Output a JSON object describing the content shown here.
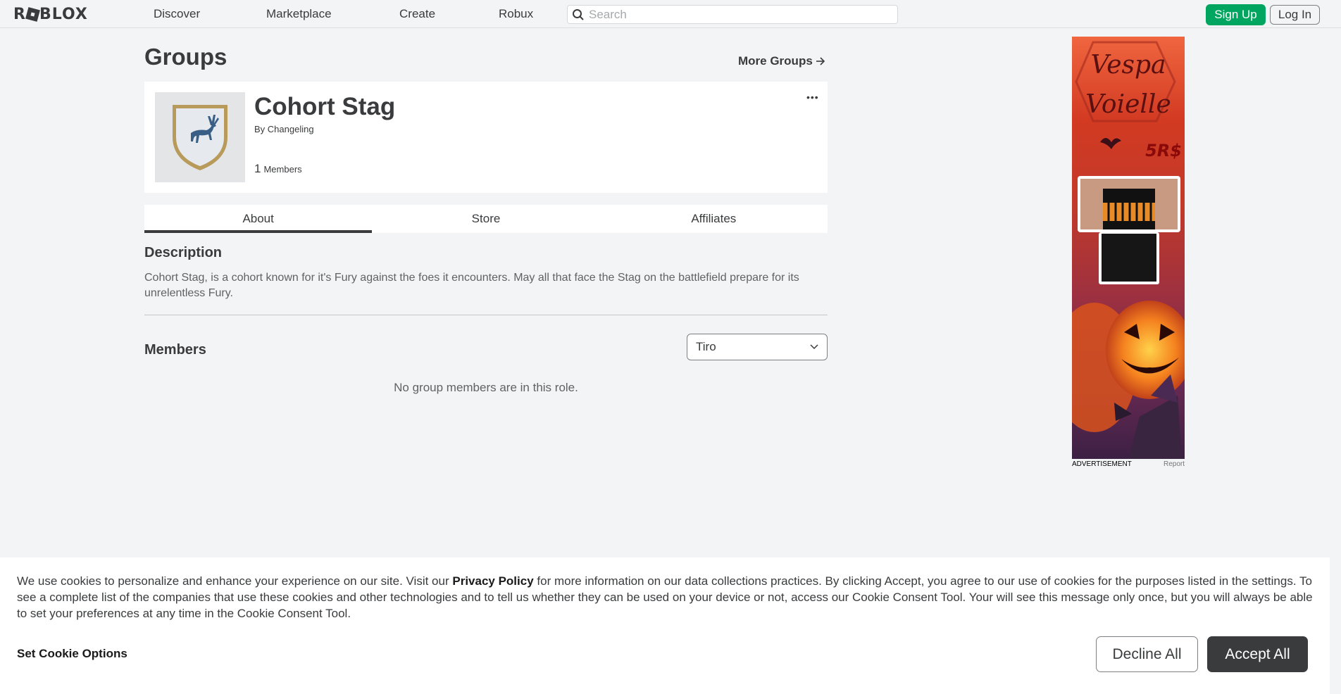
{
  "nav": {
    "logo": "ROBLOX",
    "links": [
      "Discover",
      "Marketplace",
      "Create",
      "Robux"
    ],
    "search_placeholder": "Search",
    "signup_label": "Sign Up",
    "login_label": "Log In"
  },
  "page": {
    "title": "Groups",
    "more_groups": "More Groups"
  },
  "group": {
    "name": "Cohort Stag",
    "by_label": "By",
    "owner": "Changeling",
    "member_count": "1",
    "members_label": "Members",
    "menu_glyph": "•••"
  },
  "tabs": [
    {
      "label": "About",
      "active": true
    },
    {
      "label": "Store",
      "active": false
    },
    {
      "label": "Affiliates",
      "active": false
    }
  ],
  "about": {
    "description_title": "Description",
    "description_text": "Cohort Stag, is a cohort known for it's Fury against the foes it encounters. May all that face the Stag on the battlefield prepare for its unrelentless Fury.",
    "members_title": "Members",
    "role_selected": "Tiro",
    "empty_message": "No group members are in this role."
  },
  "ad": {
    "label": "ADVERTISEMENT",
    "report": "Report",
    "line1": "Vespa",
    "line2": "Voielle",
    "price": "5R$"
  },
  "cookie": {
    "text_before": "We use cookies to personalize and enhance your experience on our site. Visit our ",
    "policy_link": "Privacy Policy",
    "text_after": " for more information on our data collections practices. By clicking Accept, you agree to our use of cookies for the purposes listed in the settings. To see a complete list of the companies that use these cookies and other technologies and to tell us whether they can be used on your device or not, access our Cookie Consent Tool. Your will see this message only once, but you will always be able to set your preferences at any time in the Cookie Consent Tool.",
    "set_options": "Set Cookie Options",
    "decline": "Decline All",
    "accept": "Accept All"
  },
  "colors": {
    "signup_green": "#00a65f",
    "text_dark": "#393b3d",
    "background": "#f2f4f5"
  }
}
